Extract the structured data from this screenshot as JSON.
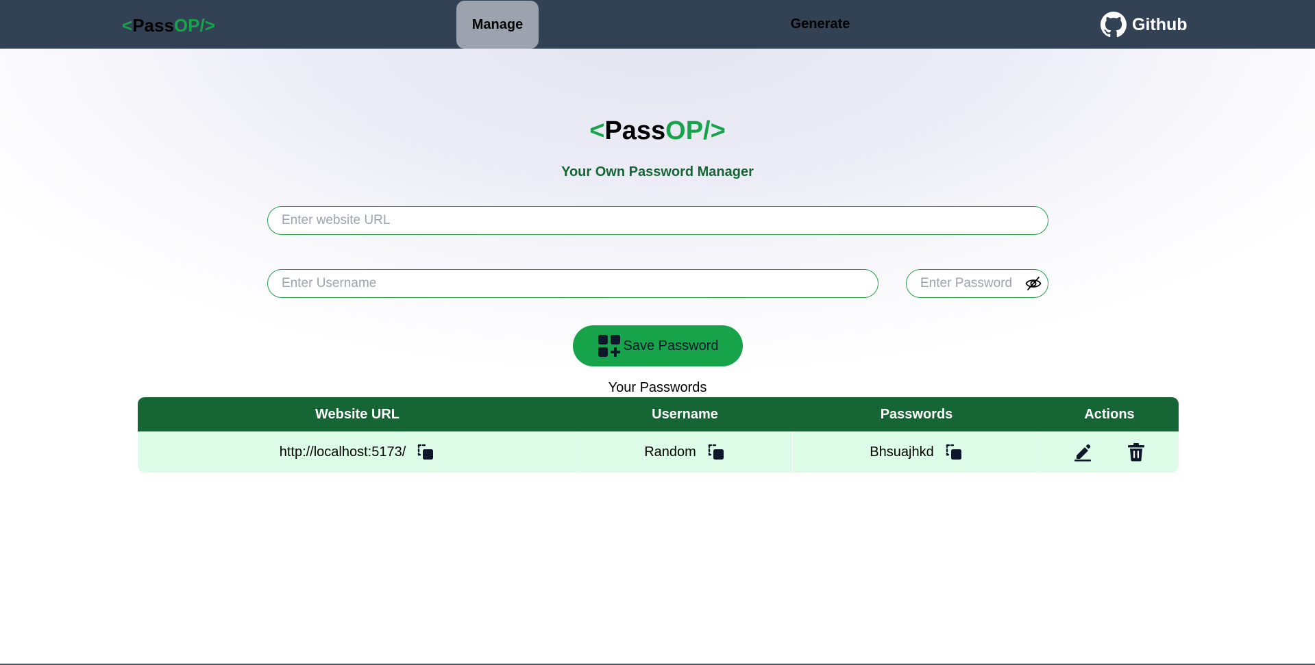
{
  "nav": {
    "brand": {
      "lt": "<",
      "pass": "Pass",
      "op": "OP/",
      "gt": ">"
    },
    "manage_label": "Manage",
    "generate_label": "Generate",
    "github_label": "Github"
  },
  "hero": {
    "logo": {
      "lt": "<",
      "pass": "Pass",
      "op": "OP/",
      "gt": ">"
    },
    "tagline": "Your Own Password Manager"
  },
  "form": {
    "url_placeholder": "Enter website URL",
    "username_placeholder": "Enter Username",
    "password_placeholder": "Enter Password",
    "save_label": "Save Password"
  },
  "passwords": {
    "title": "Your Passwords",
    "headers": [
      "Website URL",
      "Username",
      "Passwords",
      "Actions"
    ],
    "rows": [
      {
        "site": "http://localhost:5173/",
        "username": "Random",
        "password": "Bhsuajhkd"
      }
    ]
  },
  "icons": {
    "github": "github-icon",
    "eye": "eye-slash-icon",
    "save": "add-grid-icon",
    "copy": "copy-icon",
    "edit": "edit-icon",
    "delete": "trash-icon"
  },
  "colors": {
    "navbar": "#334155",
    "accent_green": "#16a34a",
    "dark_green": "#166534",
    "row_bg": "#dcfce7"
  }
}
